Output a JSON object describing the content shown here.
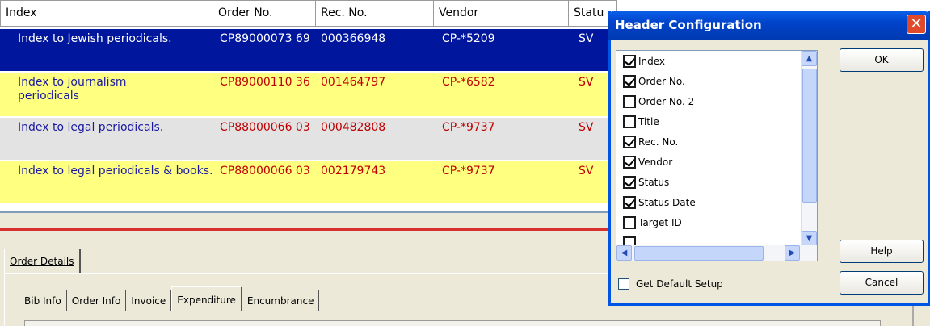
{
  "grid": {
    "columns": [
      "Index",
      "Order No.",
      "Rec. No.",
      "Vendor",
      "Statu"
    ],
    "rows": [
      {
        "index": "Index to Jewish periodicals.",
        "order": "CP89000073 69",
        "rec": "000366948",
        "vendor": "CP-*5209",
        "status": "SV"
      },
      {
        "index": "Index to journalism periodicals",
        "order": "CP89000110 36",
        "rec": "001464797",
        "vendor": "CP-*6582",
        "status": "SV"
      },
      {
        "index": "Index to legal periodicals.",
        "order": "CP88000066 03",
        "rec": "000482808",
        "vendor": "CP-*9737",
        "status": "SV"
      },
      {
        "index": "Index to legal periodicals & books.",
        "order": "CP88000066 03",
        "rec": "002179743",
        "vendor": "CP-*9737",
        "status": "SV"
      }
    ]
  },
  "bottom": {
    "main_tab": "Order Details",
    "subtabs": [
      "Bib Info",
      "Order Info",
      "Invoice",
      "Expenditure",
      "Encumbrance"
    ],
    "active_subtab": "Expenditure"
  },
  "dialog": {
    "title": "Header Configuration",
    "close": "✕",
    "items": [
      {
        "label": "Index",
        "checked": true
      },
      {
        "label": "Order No.",
        "checked": true
      },
      {
        "label": "Order No. 2",
        "checked": false
      },
      {
        "label": "Title",
        "checked": false
      },
      {
        "label": "Rec. No.",
        "checked": true
      },
      {
        "label": "Vendor",
        "checked": true
      },
      {
        "label": "Status",
        "checked": true
      },
      {
        "label": "Status Date",
        "checked": true
      },
      {
        "label": "Target ID",
        "checked": false
      }
    ],
    "default_label": "Get Default Setup",
    "ok_label": "OK",
    "help_label": "Help",
    "cancel_label": "Cancel"
  },
  "colors": {
    "selected_row_bg": "#00169c",
    "yellow_row_bg": "#ffff80",
    "gray_row_bg": "#e3e3e3",
    "text_blue": "#1a1aa0",
    "text_red": "#c00000",
    "dialog_title_bg": "#0042c9"
  }
}
